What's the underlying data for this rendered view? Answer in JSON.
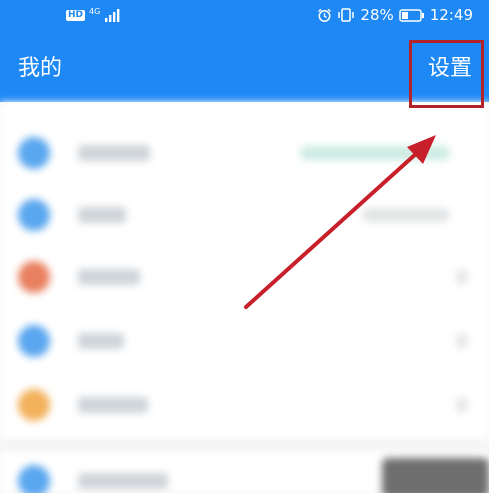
{
  "status_bar": {
    "hd_label": "HD",
    "network_label": "4G",
    "battery_percent": "28%",
    "time": "12:49",
    "icons": [
      "signal-icon",
      "alarm-icon",
      "vibrate-icon",
      "battery-icon"
    ]
  },
  "header": {
    "title": "我的",
    "settings_label": "设置"
  },
  "colors": {
    "brand_blue": "#1e88f5",
    "highlight_red": "#b3242a",
    "arrow_red": "#c8202a",
    "icon_blue": "#5aa6ef",
    "icon_orange_red": "#e9805f",
    "icon_orange": "#f2b15b",
    "badge_green": "#cdebe3"
  },
  "list": {
    "items": [
      {
        "icon_color": "#5aa6ef",
        "label_width": 72,
        "extra": "badge"
      },
      {
        "icon_color": "#5aa6ef",
        "label_width": 48,
        "extra": "pill"
      },
      {
        "icon_color": "#e9805f",
        "label_width": 62,
        "extra": "none"
      },
      {
        "icon_color": "#5aa6ef",
        "label_width": 46,
        "extra": "none"
      },
      {
        "icon_color": "#f2b15b",
        "label_width": 70,
        "extra": "none"
      },
      {
        "icon_color": "#5aa6ef",
        "label_width": 90,
        "extra": "none"
      }
    ]
  }
}
